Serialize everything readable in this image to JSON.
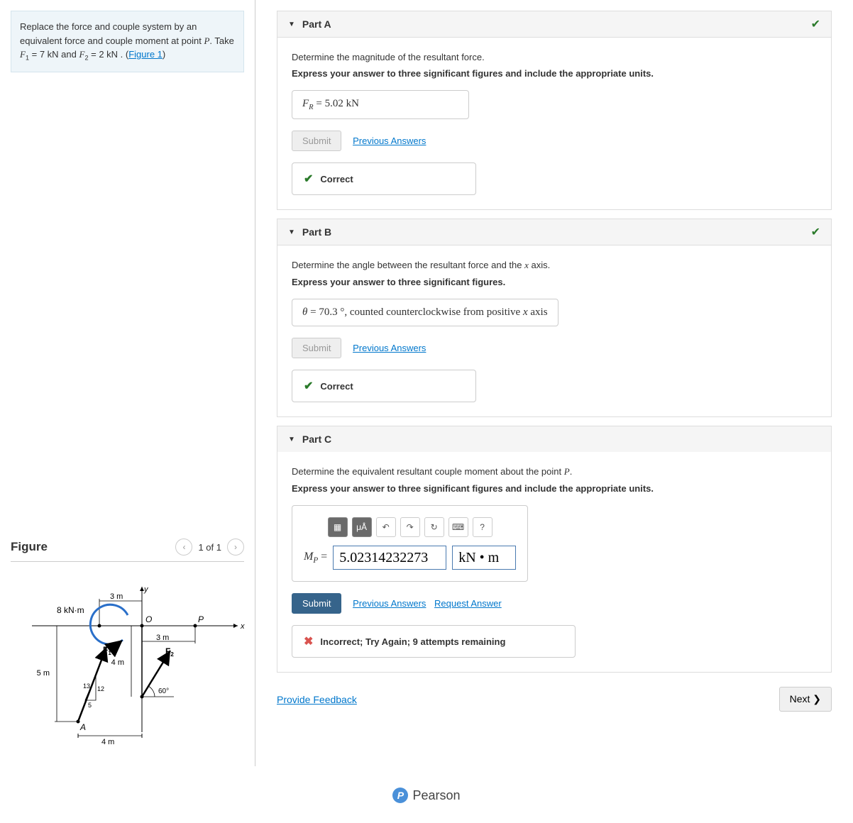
{
  "problem": {
    "text_1": "Replace the force and couple system by an equivalent force and couple moment at point ",
    "point": "P",
    "text_2": ". Take ",
    "f1_var": "F",
    "f1_sub": "1",
    "f1_val": " = 7 kN",
    "text_3": " and ",
    "f2_var": "F",
    "f2_sub": "2",
    "f2_val": " = 2 kN",
    "text_4": " . (",
    "figure_link": "Figure 1",
    "text_5": ")"
  },
  "figure": {
    "title": "Figure",
    "count": "1 of 1",
    "labels": {
      "moment": "8 kN·m",
      "dim_5m": "5 m",
      "dim_4m_v": "4 m",
      "dim_4m_h": "4 m",
      "dim_3m_1": "3 m",
      "dim_3m_2": "3 m",
      "y": "y",
      "x": "x",
      "O": "O",
      "P": "P",
      "A": "A",
      "F1": "F",
      "F1_sub": "1",
      "F2": "F",
      "F2_sub": "2",
      "angle": "60°",
      "tri_13": "13",
      "tri_12": "12",
      "tri_5": "5"
    }
  },
  "partA": {
    "title": "Part A",
    "prompt": "Determine the magnitude of the resultant force.",
    "instruction": "Express your answer to three significant figures and include the appropriate units.",
    "answer_var": "F",
    "answer_sub": "R",
    "answer_eq": " = ",
    "answer_val": "5.02 kN",
    "submit": "Submit",
    "prev": "Previous Answers",
    "feedback": "Correct"
  },
  "partB": {
    "title": "Part B",
    "prompt_1": "Determine the angle between the resultant force and the ",
    "prompt_var": "x",
    "prompt_2": " axis.",
    "instruction": "Express your answer to three significant figures.",
    "answer_var": "θ",
    "answer_eq": " = ",
    "answer_val": "70.3",
    "answer_unit": " °",
    "answer_suffix": ", counted counterclockwise from positive ",
    "answer_suffix_var": "x",
    "answer_suffix_2": " axis",
    "submit": "Submit",
    "prev": "Previous Answers",
    "feedback": "Correct"
  },
  "partC": {
    "title": "Part C",
    "prompt_1": "Determine the equivalent resultant couple moment about the point ",
    "prompt_var": "P",
    "prompt_2": ".",
    "instruction": "Express your answer to three significant figures and include the appropriate units.",
    "var": "M",
    "var_sub": "P",
    "eq": " = ",
    "value": "5.02314232273",
    "unit": "kN • m",
    "submit": "Submit",
    "prev": "Previous Answers",
    "req": "Request Answer",
    "feedback": "Incorrect; Try Again; 9 attempts remaining",
    "tool_mu": "μÅ",
    "tool_q": "?"
  },
  "bottom": {
    "feedback": "Provide Feedback",
    "next": "Next ❯"
  },
  "footer": {
    "brand": "Pearson"
  }
}
